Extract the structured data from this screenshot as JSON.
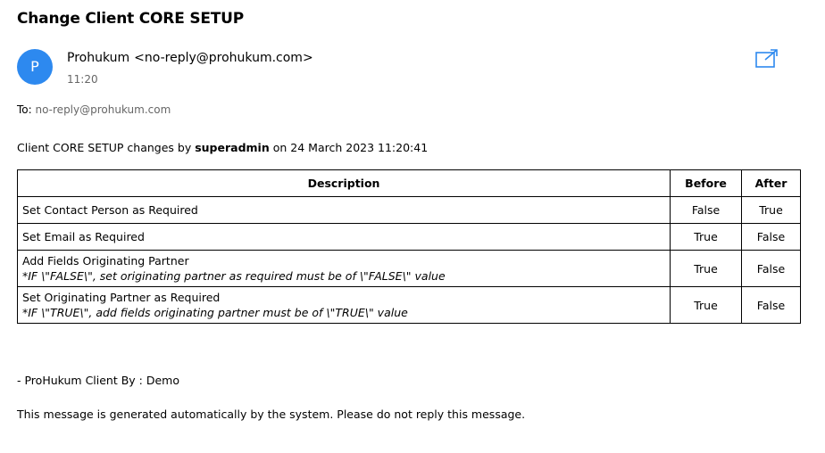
{
  "email": {
    "subject": "Change Client CORE SETUP",
    "avatar_letter": "P",
    "avatar_color": "#2d89ef",
    "sender_name": "Prohukum",
    "sender_email": "<no-reply@prohukum.com>",
    "time": "11:20",
    "to_label": "To:",
    "to_value": "no-reply@prohukum.com",
    "popout_icon": "open-in-new-window-icon"
  },
  "body": {
    "summary_prefix": "Client CORE SETUP changes by",
    "summary_user": "superadmin",
    "summary_suffix": "on 24 March 2023 11:20:41",
    "table": {
      "headers": {
        "description": "Description",
        "before": "Before",
        "after": "After"
      },
      "rows": [
        {
          "description": "Set Contact Person as Required",
          "note": "",
          "before": "False",
          "after": "True"
        },
        {
          "description": "Set Email as Required",
          "note": "",
          "before": "True",
          "after": "False"
        },
        {
          "description": "Add Fields Originating Partner",
          "note": "*IF \\\"FALSE\\\", set originating partner as required must be of \\\"FALSE\\\" value",
          "before": "True",
          "after": "False"
        },
        {
          "description": "Set Originating Partner as Required",
          "note": "*IF \\\"TRUE\\\", add fields originating partner must be of \\\"TRUE\\\" value",
          "before": "True",
          "after": "False"
        }
      ]
    },
    "footer_by": "- ProHukum Client By : Demo",
    "footer_note": "This message is generated automatically by the system. Please do not reply this message."
  }
}
